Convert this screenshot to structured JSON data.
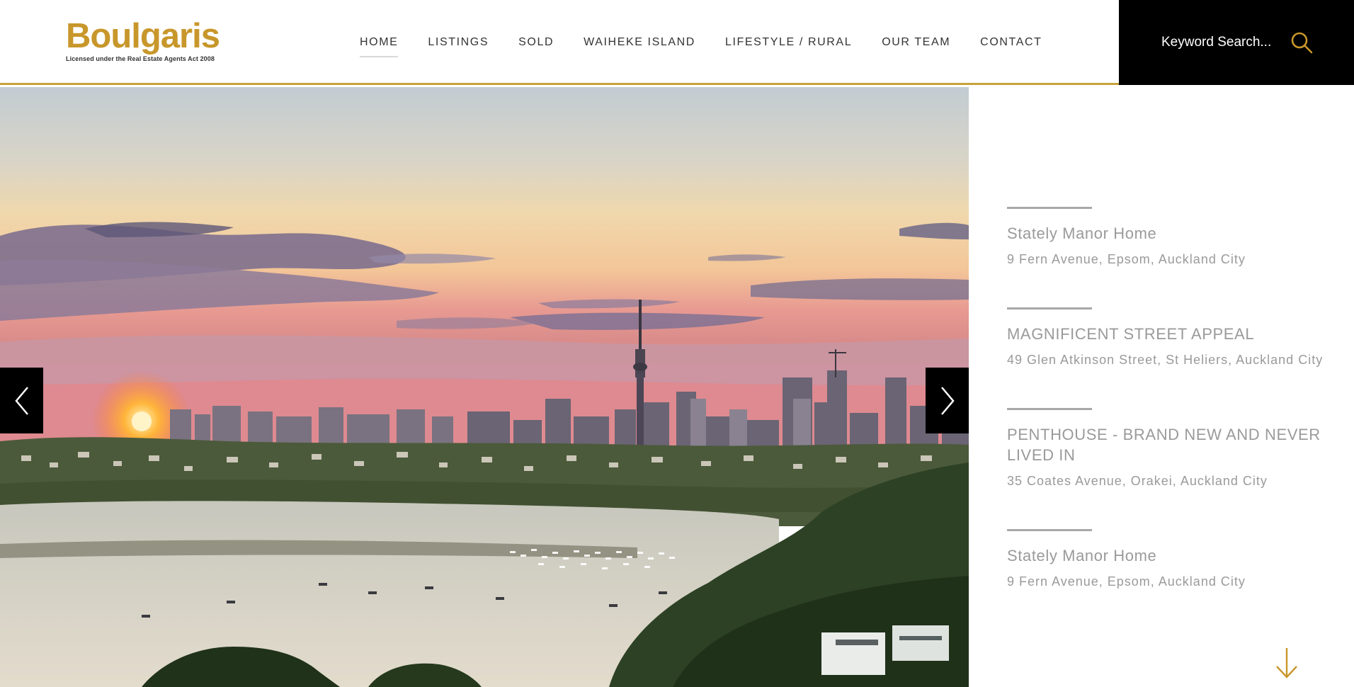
{
  "brand": {
    "name": "Boulgaris",
    "tagline": "Licensed under the Real Estate Agents Act 2008",
    "accent_color": "#c8972b"
  },
  "nav": {
    "items": [
      {
        "label": "HOME",
        "active": true
      },
      {
        "label": "LISTINGS",
        "active": false
      },
      {
        "label": "SOLD",
        "active": false
      },
      {
        "label": "WAIHEKE ISLAND",
        "active": false
      },
      {
        "label": "LIFESTYLE / RURAL",
        "active": false
      },
      {
        "label": "OUR TEAM",
        "active": false
      },
      {
        "label": "CONTACT",
        "active": false
      }
    ]
  },
  "search": {
    "placeholder": "Keyword Search...",
    "value": "",
    "icon": "search-icon"
  },
  "hero": {
    "prev_icon": "chevron-left-icon",
    "next_icon": "chevron-right-icon"
  },
  "listings": [
    {
      "title": "Stately Manor Home",
      "address": "9 Fern Avenue, Epsom, Auckland City"
    },
    {
      "title": "MAGNIFICENT STREET APPEAL",
      "address": "49 Glen Atkinson Street, St Heliers, Auckland City"
    },
    {
      "title": "PENTHOUSE - BRAND NEW AND NEVER LIVED IN",
      "address": "35 Coates Avenue, Orakei, Auckland City"
    },
    {
      "title": "Stately Manor Home",
      "address": "9 Fern Avenue, Epsom, Auckland City"
    }
  ],
  "scroll": {
    "icon": "arrow-down-icon"
  }
}
